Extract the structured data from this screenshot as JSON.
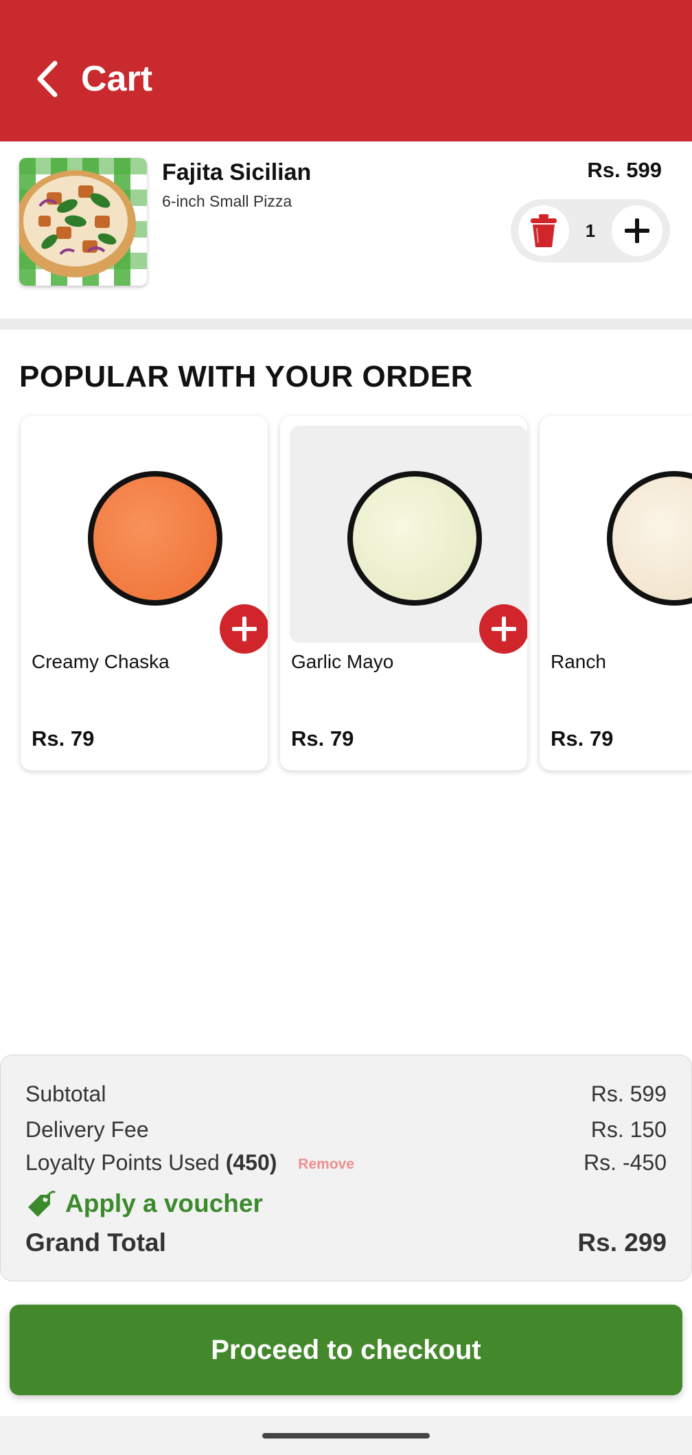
{
  "header": {
    "title": "Cart",
    "back_icon": "chevron-left-icon",
    "background_color": "#c92a2e"
  },
  "cart": {
    "items": [
      {
        "name": "Fajita Sicilian",
        "description": "6-inch Small Pizza",
        "price": "Rs. 599",
        "quantity": "1",
        "image": "pizza-image"
      }
    ],
    "trash_icon": "trash-icon",
    "plus_icon": "plus-icon"
  },
  "popular": {
    "title": "POPULAR WITH YOUR ORDER",
    "products": [
      {
        "name": "Creamy Chaska",
        "price": "Rs. 79",
        "sauce_color": "#f47a3d"
      },
      {
        "name": "Garlic Mayo",
        "price": "Rs. 79",
        "sauce_color": "#eef1cf"
      },
      {
        "name": "Ranch",
        "price": "Rs. 79",
        "sauce_color": "#f7ecd9"
      }
    ],
    "add_icon": "plus-circle-icon"
  },
  "summary": {
    "subtotal_label": "Subtotal",
    "subtotal_value": "Rs. 599",
    "delivery_label": "Delivery Fee",
    "delivery_value": "Rs. 150",
    "loyalty_label": "Loyalty Points Used",
    "loyalty_points": "(450)",
    "loyalty_remove": "Remove",
    "loyalty_value": "Rs. -450",
    "voucher_label": "Apply a voucher",
    "voucher_icon": "tag-icon",
    "grand_total_label": "Grand Total",
    "grand_total_value": "Rs. 299"
  },
  "checkout": {
    "label": "Proceed to checkout",
    "color": "#43892b"
  },
  "colors": {
    "brand_red": "#c92a2e",
    "accent_green": "#3b8a2c"
  }
}
